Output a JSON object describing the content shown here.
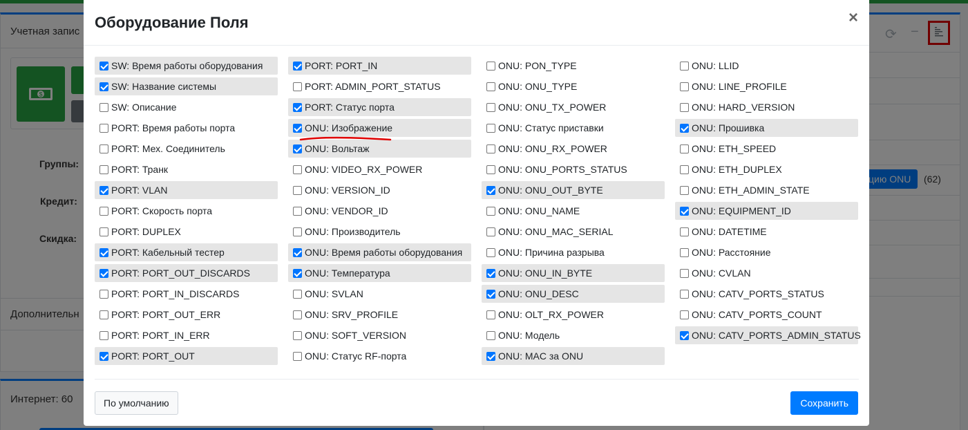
{
  "background": {
    "account_title": "Учетная запис",
    "groups_label": "Группы:",
    "credit_label": "Кредит:",
    "discount_label": "Скидка:",
    "additional_label": "Дополнительн",
    "internet_label": "Интернет: 60",
    "onu_button": "цию ONU",
    "onu_count": "(62)"
  },
  "modal": {
    "title": "Оборудование Поля",
    "close": "×",
    "default_button": "По умолчанию",
    "save_button": "Сохранить"
  },
  "columns": [
    [
      {
        "label": "SW: Время работы оборудования",
        "checked": true
      },
      {
        "label": "SW: Название системы",
        "checked": true
      },
      {
        "label": "SW: Описание",
        "checked": false
      },
      {
        "label": "PORT: Время работы порта",
        "checked": false
      },
      {
        "label": "PORT: Мех. Соединитель",
        "checked": false
      },
      {
        "label": "PORT: Транк",
        "checked": false
      },
      {
        "label": "PORT: VLAN",
        "checked": true
      },
      {
        "label": "PORT: Скорость порта",
        "checked": false
      },
      {
        "label": "PORT: DUPLEX",
        "checked": false
      },
      {
        "label": "PORT: Кабельный тестер",
        "checked": true
      },
      {
        "label": "PORT: PORT_OUT_DISCARDS",
        "checked": true
      },
      {
        "label": "PORT: PORT_IN_DISCARDS",
        "checked": false
      },
      {
        "label": "PORT: PORT_OUT_ERR",
        "checked": false
      },
      {
        "label": "PORT: PORT_IN_ERR",
        "checked": false
      },
      {
        "label": "PORT: PORT_OUT",
        "checked": true
      }
    ],
    [
      {
        "label": "PORT: PORT_IN",
        "checked": true
      },
      {
        "label": "PORT: ADMIN_PORT_STATUS",
        "checked": false
      },
      {
        "label": "PORT: Статус порта",
        "checked": true
      },
      {
        "label": "ONU: Изображение",
        "checked": true
      },
      {
        "label": "ONU: Вольтаж",
        "checked": true
      },
      {
        "label": "ONU: VIDEO_RX_POWER",
        "checked": false
      },
      {
        "label": "ONU: VERSION_ID",
        "checked": false
      },
      {
        "label": "ONU: VENDOR_ID",
        "checked": false
      },
      {
        "label": "ONU: Производитель",
        "checked": false
      },
      {
        "label": "ONU: Время работы оборудования",
        "checked": true
      },
      {
        "label": "ONU: Температура",
        "checked": true
      },
      {
        "label": "ONU: SVLAN",
        "checked": false
      },
      {
        "label": "ONU: SRV_PROFILE",
        "checked": false
      },
      {
        "label": "ONU: SOFT_VERSION",
        "checked": false
      },
      {
        "label": "ONU: Статус RF-порта",
        "checked": false
      }
    ],
    [
      {
        "label": "ONU: PON_TYPE",
        "checked": false
      },
      {
        "label": "ONU: ONU_TYPE",
        "checked": false
      },
      {
        "label": "ONU: ONU_TX_POWER",
        "checked": false
      },
      {
        "label": "ONU: Статус приставки",
        "checked": false
      },
      {
        "label": "ONU: ONU_RX_POWER",
        "checked": false
      },
      {
        "label": "ONU: ONU_PORTS_STATUS",
        "checked": false
      },
      {
        "label": "ONU: ONU_OUT_BYTE",
        "checked": true
      },
      {
        "label": "ONU: ONU_NAME",
        "checked": false
      },
      {
        "label": "ONU: ONU_MAC_SERIAL",
        "checked": false
      },
      {
        "label": "ONU: Причина разрыва",
        "checked": false
      },
      {
        "label": "ONU: ONU_IN_BYTE",
        "checked": true
      },
      {
        "label": "ONU: ONU_DESC",
        "checked": true
      },
      {
        "label": "ONU: OLT_RX_POWER",
        "checked": false
      },
      {
        "label": "ONU: Модель",
        "checked": false
      },
      {
        "label": "ONU: MAC за ONU",
        "checked": true
      }
    ],
    [
      {
        "label": "ONU: LLID",
        "checked": false
      },
      {
        "label": "ONU: LINE_PROFILE",
        "checked": false
      },
      {
        "label": "ONU: HARD_VERSION",
        "checked": false
      },
      {
        "label": "ONU: Прошивка",
        "checked": true
      },
      {
        "label": "ONU: ETH_SPEED",
        "checked": false
      },
      {
        "label": "ONU: ETH_DUPLEX",
        "checked": false
      },
      {
        "label": "ONU: ETH_ADMIN_STATE",
        "checked": false
      },
      {
        "label": "ONU: EQUIPMENT_ID",
        "checked": true
      },
      {
        "label": "ONU: DATETIME",
        "checked": false
      },
      {
        "label": "ONU: Расстояние",
        "checked": false
      },
      {
        "label": "ONU: CVLAN",
        "checked": false
      },
      {
        "label": "ONU: CATV_PORTS_STATUS",
        "checked": false
      },
      {
        "label": "ONU: CATV_PORTS_COUNT",
        "checked": false
      },
      {
        "label": "ONU: CATV_PORTS_ADMIN_STATUS",
        "checked": true
      }
    ]
  ],
  "colors": {
    "accent": "#007bff",
    "checked_row_bg": "#e5e5e5",
    "highlight_underline": "#e00000",
    "highlight_box": "#e00000"
  }
}
